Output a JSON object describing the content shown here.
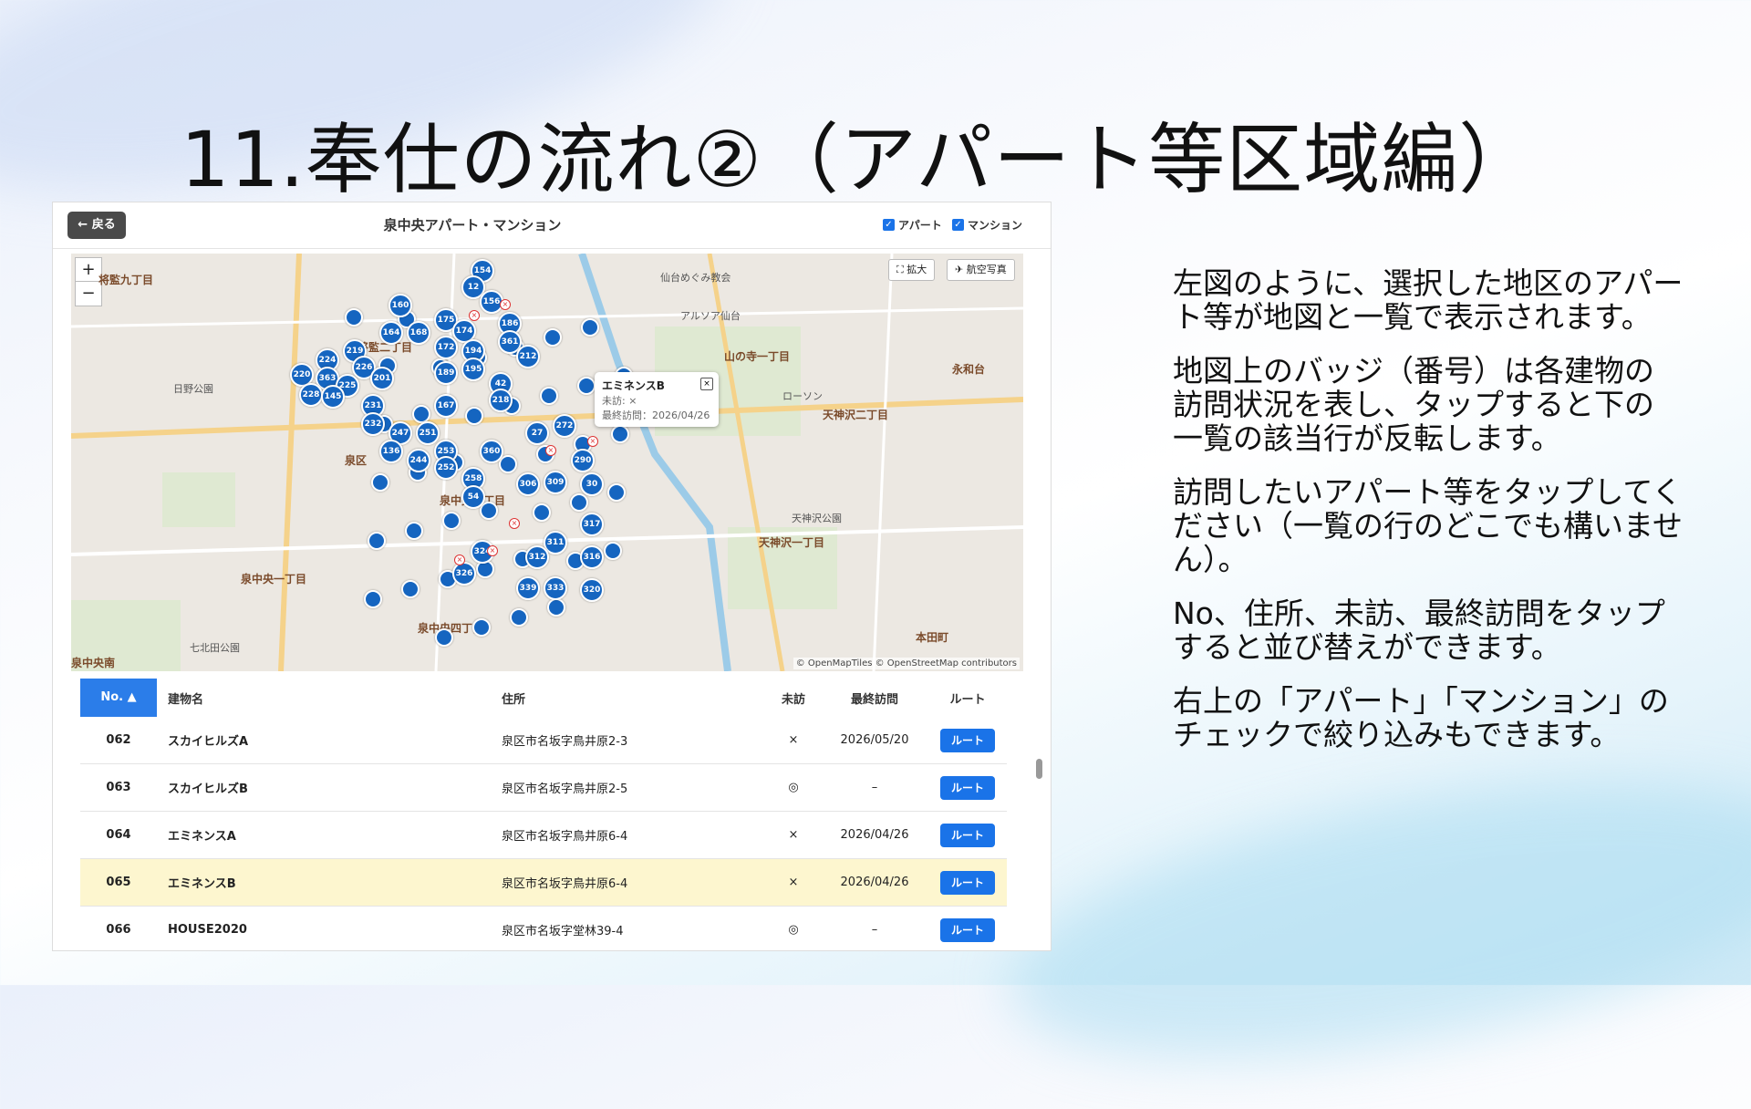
{
  "slide": {
    "title": "11.奉仕の流れ②（アパート等区域編）",
    "paragraphs": [
      "左図のように、選択した地区のアパート等が地図と一覧で表示されます。",
      "地図上のバッジ（番号）は各建物の訪問状況を表し、タップすると下の一覧の該当行が反転します。",
      "訪問したいアパート等をタップしてください（一覧の行のどこでも構いません）。",
      "No、住所、未訪、最終訪問をタップすると並び替えができます。",
      "右上の「アパート」「マンション」のチェックで絞り込みもできます。"
    ]
  },
  "app": {
    "back_label": "← 戻る",
    "title": "泉中央アパート・マンション",
    "filters": [
      {
        "label": "アパート",
        "checked": true
      },
      {
        "label": "マンション",
        "checked": true
      }
    ]
  },
  "map": {
    "zoom_in": "+",
    "zoom_out": "−",
    "expand_label": "⛶ 拡大",
    "aerial_label": "✈ 航空写真",
    "attribution": "© OpenMapTiles © OpenStreetMap contributors",
    "labels": [
      "将監九丁目",
      "将監二丁目",
      "山の寺一丁目",
      "泉中央三丁目",
      "泉中央一丁目",
      "泉中央四丁目",
      "天神沢二丁目",
      "天神沢一丁目",
      "泉区",
      "永和台",
      "本田町",
      "日野公園",
      "仙台めぐみ教会",
      "アルソア仙台",
      "ローソン",
      "泉中央南",
      "七北田公園",
      "天神沢公園"
    ],
    "pins": [
      "154",
      "12",
      "156",
      "160",
      "175",
      "174",
      "186",
      "361",
      "212",
      "164",
      "168",
      "172",
      "194",
      "224",
      "219",
      "226",
      "363",
      "225",
      "220",
      "228",
      "145",
      "201",
      "189",
      "195",
      "42",
      "218",
      "231",
      "232",
      "247",
      "251",
      "253",
      "244",
      "252",
      "27",
      "272",
      "360",
      "258",
      "54",
      "290",
      "306",
      "309",
      "30",
      "317",
      "311",
      "312",
      "324",
      "316",
      "326",
      "339",
      "333",
      "320",
      "136",
      "167"
    ],
    "popup": {
      "name": "エミネンスB",
      "status": "未訪: ×",
      "last_visit": "最終訪問：2026/04/26",
      "close": "×"
    }
  },
  "table": {
    "headers": {
      "no": "No. ▲",
      "name": "建物名",
      "address": "住所",
      "unvisited": "未訪",
      "last_visit": "最終訪問",
      "route": "ルート"
    },
    "rows": [
      {
        "no": "062",
        "name": "スカイヒルズA",
        "address": "泉区市名坂字鳥井原2-3",
        "unvisited": "×",
        "last_visit": "2026/05/20",
        "route": "ルート",
        "highlight": false
      },
      {
        "no": "063",
        "name": "スカイヒルズB",
        "address": "泉区市名坂字鳥井原2-5",
        "unvisited": "◎",
        "last_visit": "–",
        "route": "ルート",
        "highlight": false
      },
      {
        "no": "064",
        "name": "エミネンスA",
        "address": "泉区市名坂字鳥井原6-4",
        "unvisited": "×",
        "last_visit": "2026/04/26",
        "route": "ルート",
        "highlight": false
      },
      {
        "no": "065",
        "name": "エミネンスB",
        "address": "泉区市名坂字鳥井原6-4",
        "unvisited": "×",
        "last_visit": "2026/04/26",
        "route": "ルート",
        "highlight": true
      },
      {
        "no": "066",
        "name": "HOUSE2020",
        "address": "泉区市名坂字堂林39-4",
        "unvisited": "◎",
        "last_visit": "–",
        "route": "ルート",
        "highlight": false
      }
    ]
  },
  "colors": {
    "pin": "#1565c0",
    "accent": "#1a73e8",
    "highlight_row": "#fdf6cf"
  }
}
